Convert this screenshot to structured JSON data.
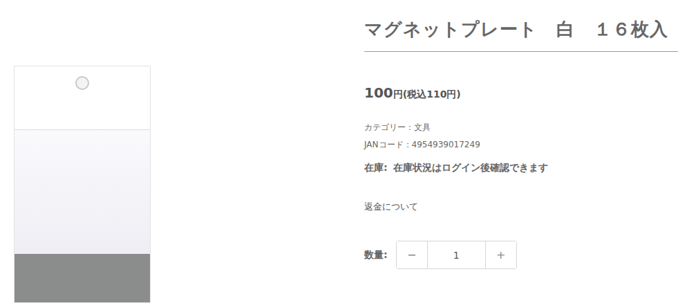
{
  "product": {
    "title": "マグネットプレート　白　１６枚入",
    "price": {
      "amount": "100",
      "suffix": "円(税込110円)"
    },
    "meta": [
      "カテゴリー：文具",
      "JANコード：4954939017249"
    ],
    "stock": {
      "label": "在庫:",
      "value": "在庫状況はログイン後確認できます"
    },
    "refund_link": "返金について",
    "quantity": {
      "label": "数量:",
      "value": "1",
      "minus": "−",
      "plus": "+"
    }
  }
}
